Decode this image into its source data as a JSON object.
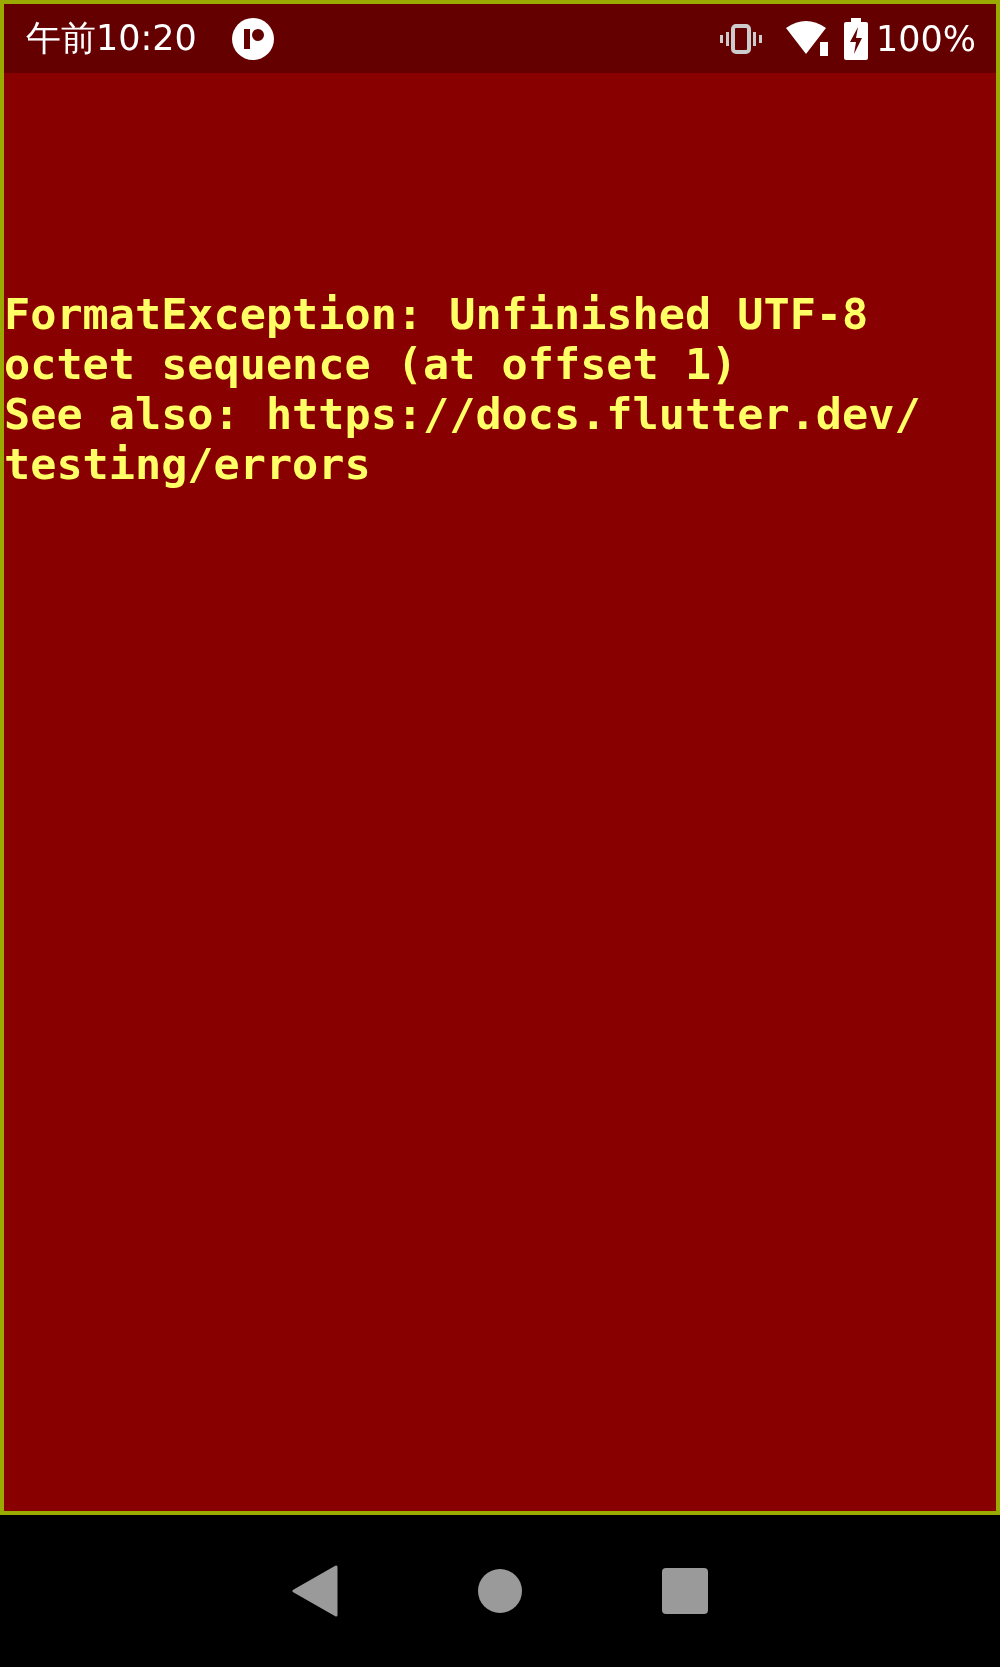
{
  "status_bar": {
    "time": "午前10:20",
    "battery": "100%"
  },
  "error": {
    "message": "FormatException: Unfinished UTF-8 octet sequence (at offset 1)",
    "see_also": "See also: https://docs.flutter.dev/testing/errors"
  }
}
